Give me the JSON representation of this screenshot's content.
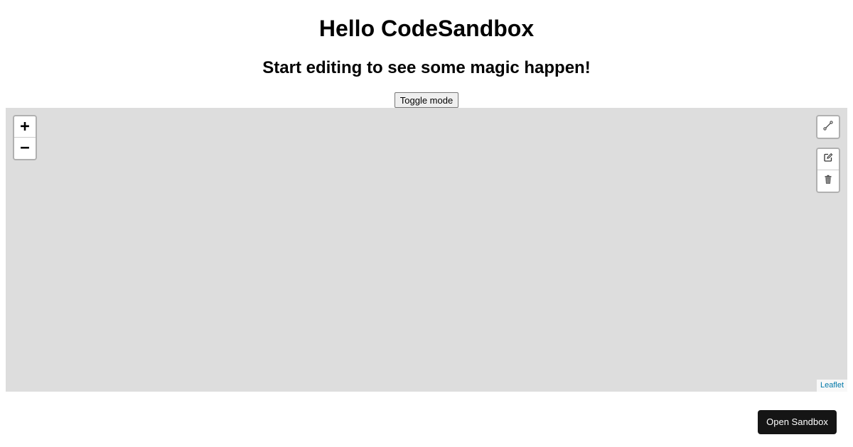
{
  "header": {
    "title": "Hello CodeSandbox",
    "subtitle": "Start editing to see some magic happen!"
  },
  "controls": {
    "toggle_label": "Toggle mode"
  },
  "map": {
    "zoom_in_label": "+",
    "zoom_out_label": "−",
    "draw_toolbar": {
      "polyline_icon": "polyline-icon"
    },
    "edit_toolbar": {
      "edit_icon": "edit-layers-icon",
      "delete_icon": "trash-icon"
    },
    "attribution": "Leaflet",
    "background_color": "#dddddd"
  },
  "footer": {
    "open_sandbox_label": "Open Sandbox",
    "button_color": "#151515"
  }
}
